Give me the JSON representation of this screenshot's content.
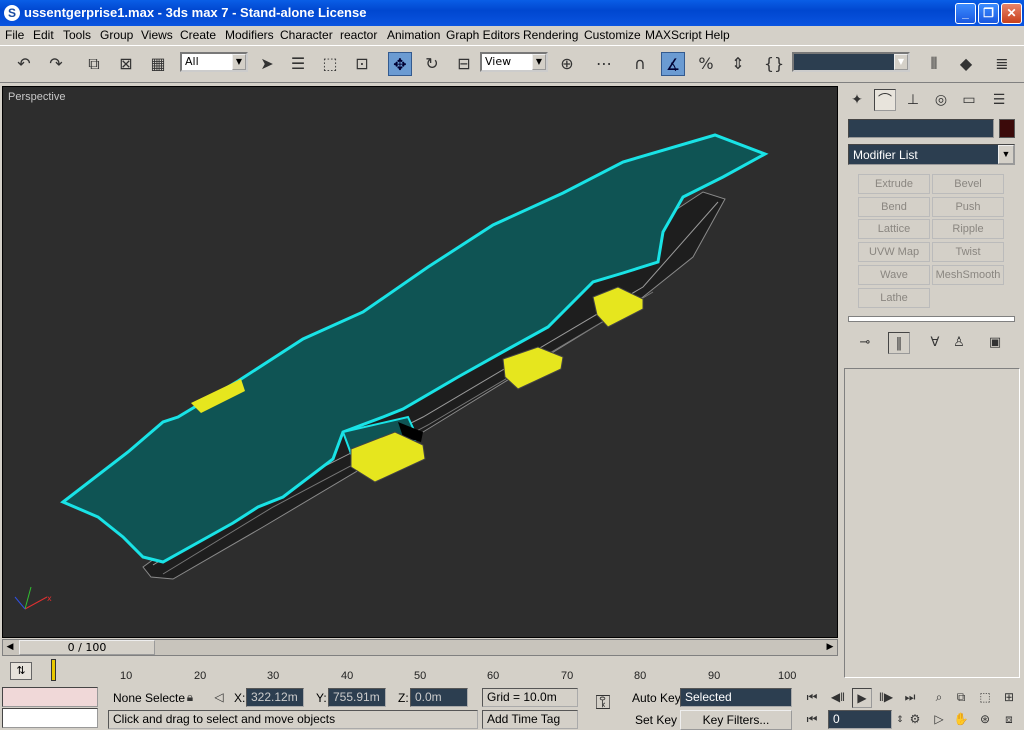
{
  "title": "ussentgerprise1.max - 3ds max 7  - Stand-alone License",
  "menu": [
    "File",
    "Edit",
    "Tools",
    "Group",
    "Views",
    "Create",
    "Modifiers",
    "Character",
    "reactor",
    "Animation",
    "Graph Editors",
    "Rendering",
    "Customize",
    "MAXScript",
    "Help"
  ],
  "toolbar": {
    "selection_filter": "All",
    "reference_coord": "View",
    "named_selection": ""
  },
  "viewport": {
    "label": "Perspective"
  },
  "command_panel": {
    "object_name": "",
    "modifier_list": "Modifier List",
    "modifiers": [
      "Extrude",
      "Bevel",
      "Bend",
      "Push",
      "Lattice",
      "Ripple",
      "UVW Map",
      "Twist",
      "Wave",
      "MeshSmooth",
      "Lathe"
    ]
  },
  "timeline": {
    "frame_display": "0 / 100",
    "ruler_labels": [
      "10",
      "20",
      "30",
      "40",
      "50",
      "60",
      "70",
      "80",
      "90",
      "100"
    ]
  },
  "status": {
    "selection": "None Selecte",
    "x_label": "X:",
    "x_value": "322.12m",
    "y_label": "Y:",
    "y_value": "755.91m",
    "z_label": "Z:",
    "z_value": "0.0m",
    "grid": "Grid = 10.0m",
    "prompt": "Click and drag to select and move objects",
    "add_time_tag": "Add Time Tag",
    "auto_key": "Auto Key",
    "set_key": "Set Key",
    "key_mode": "Selected",
    "key_filters": "Key Filters...",
    "current_frame": "0"
  },
  "colors": {
    "deck": "#0f5454",
    "deck_edge": "#19e3e6",
    "elevator": "#e6e61e",
    "viewport_bg": "#2d2d2d"
  }
}
